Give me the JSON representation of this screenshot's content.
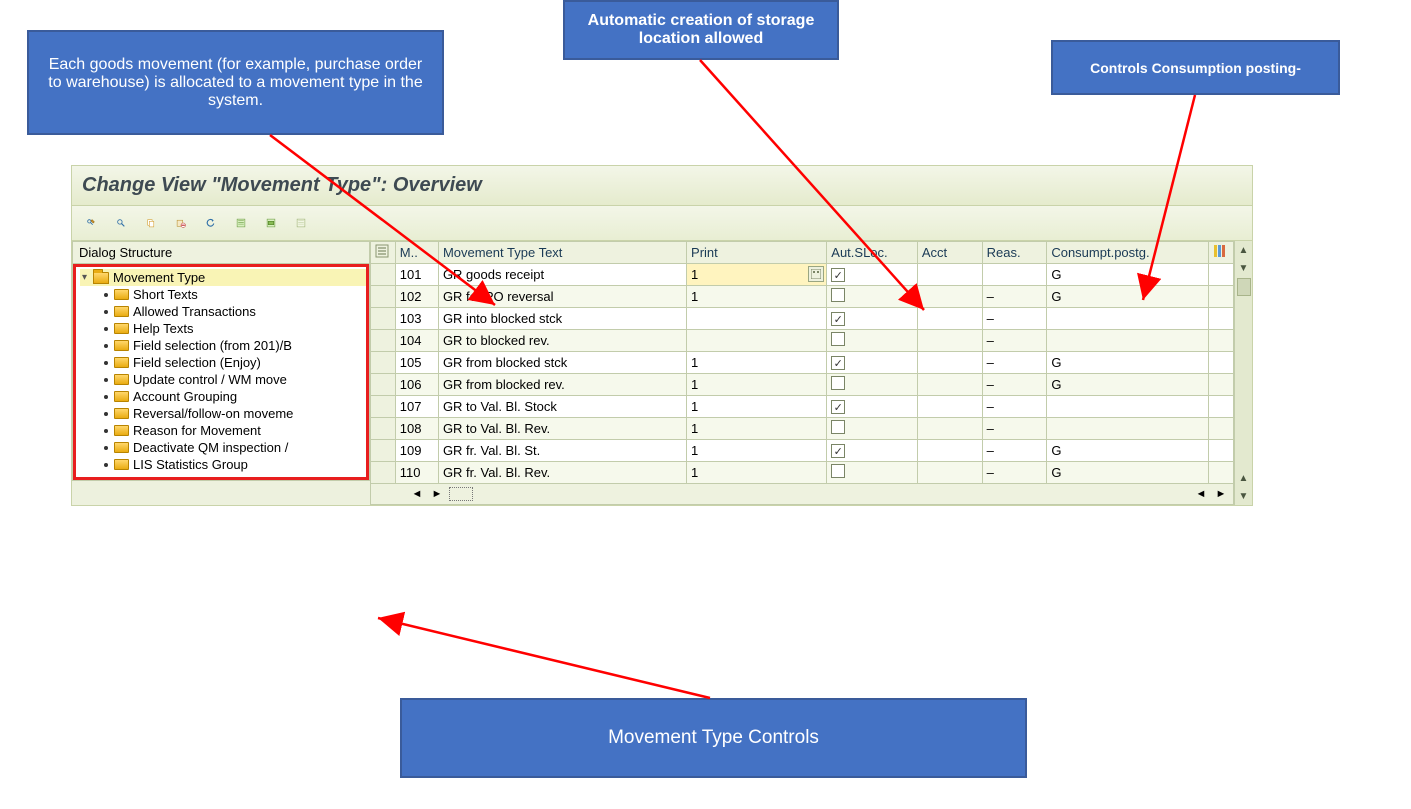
{
  "callouts": {
    "movement_desc": "Each goods movement (for example, purchase order to warehouse) is allocated to a movement type in the system.",
    "auto_creation": "Automatic creation of storage location allowed",
    "consumption": "Controls Consumption posting-",
    "controls": "Movement Type Controls"
  },
  "sap": {
    "title": "Change View \"Movement Type\": Overview",
    "toolbar": {
      "display_change": "Display/Change",
      "find": "Find",
      "copy": "Copy",
      "delete": "Delete",
      "undo": "Undo",
      "select_all": "Select All",
      "select_block": "Select Block",
      "deselect_all": "Deselect All"
    },
    "tree": {
      "header": "Dialog Structure",
      "root": "Movement Type",
      "items": [
        "Short Texts",
        "Allowed Transactions",
        "Help Texts",
        "Field selection (from 201)/B",
        "Field selection (Enjoy)",
        "Update control / WM move",
        "Account Grouping",
        "Reversal/follow-on moveme",
        "Reason for Movement",
        "Deactivate QM inspection /",
        "LIS Statistics Group"
      ]
    },
    "columns": {
      "m": "M..",
      "text": "Movement Type Text",
      "print": "Print",
      "aut": "Aut.SLoc.",
      "acct": "Acct",
      "reas": "Reas.",
      "cons": "Consumpt.postg."
    },
    "rows": [
      {
        "m": "101",
        "text": "GR goods receipt",
        "print": "1",
        "aut": true,
        "acct": "",
        "reas": "",
        "cons": "G",
        "edit": true
      },
      {
        "m": "102",
        "text": "GR for PO   reversal",
        "print": "1",
        "aut": false,
        "acct": "",
        "reas": "–",
        "cons": "G"
      },
      {
        "m": "103",
        "text": "GR into blocked stck",
        "print": "",
        "aut": true,
        "acct": "",
        "reas": "–",
        "cons": ""
      },
      {
        "m": "104",
        "text": "GR to blocked rev.",
        "print": "",
        "aut": false,
        "acct": "",
        "reas": "–",
        "cons": ""
      },
      {
        "m": "105",
        "text": "GR from blocked stck",
        "print": "1",
        "aut": true,
        "acct": "",
        "reas": "–",
        "cons": "G"
      },
      {
        "m": "106",
        "text": "GR from blocked rev.",
        "print": "1",
        "aut": false,
        "acct": "",
        "reas": "–",
        "cons": "G"
      },
      {
        "m": "107",
        "text": "GR to Val. Bl. Stock",
        "print": "1",
        "aut": true,
        "acct": "",
        "reas": "–",
        "cons": ""
      },
      {
        "m": "108",
        "text": "GR to Val. Bl. Rev.",
        "print": "1",
        "aut": false,
        "acct": "",
        "reas": "–",
        "cons": ""
      },
      {
        "m": "109",
        "text": "GR fr. Val. Bl. St.",
        "print": "1",
        "aut": true,
        "acct": "",
        "reas": "–",
        "cons": "G"
      },
      {
        "m": "110",
        "text": "GR fr. Val. Bl. Rev.",
        "print": "1",
        "aut": false,
        "acct": "",
        "reas": "–",
        "cons": "G"
      }
    ]
  }
}
